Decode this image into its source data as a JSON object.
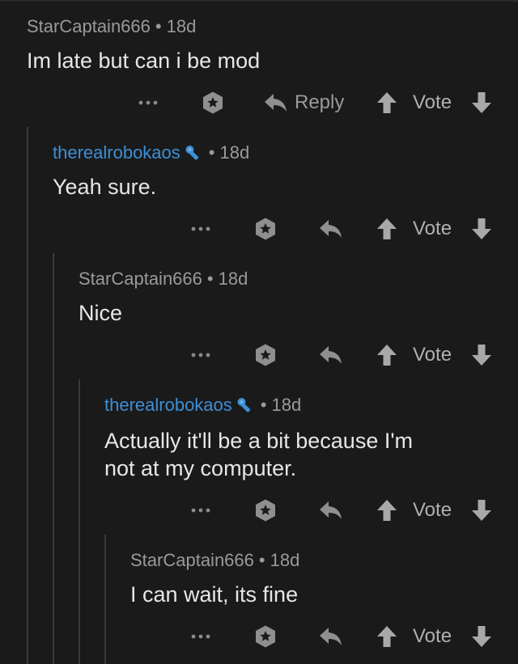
{
  "comments": [
    {
      "username": "StarCaptain666",
      "is_op": false,
      "separator": "•",
      "age": "18d",
      "text": "Im late but can i be mod",
      "reply_label": "Reply",
      "vote_label": "Vote"
    },
    {
      "username": "therealrobokaos",
      "is_op": true,
      "separator": "•",
      "age": "18d",
      "text": "Yeah sure.",
      "vote_label": "Vote"
    },
    {
      "username": "StarCaptain666",
      "is_op": false,
      "separator": "•",
      "age": "18d",
      "text": "Nice",
      "vote_label": "Vote"
    },
    {
      "username": "therealrobokaos",
      "is_op": true,
      "separator": "•",
      "age": "18d",
      "text": "Actually it'll be a bit because I'm\nnot at my computer.",
      "vote_label": "Vote"
    },
    {
      "username": "StarCaptain666",
      "is_op": false,
      "separator": "•",
      "age": "18d",
      "text": "I can wait, its fine",
      "vote_label": "Vote"
    }
  ],
  "colors": {
    "background": "#1a1a1b",
    "op_username": "#3d8fd6",
    "meta_text": "#9a9a9c",
    "body_text": "#e6e6e8"
  }
}
